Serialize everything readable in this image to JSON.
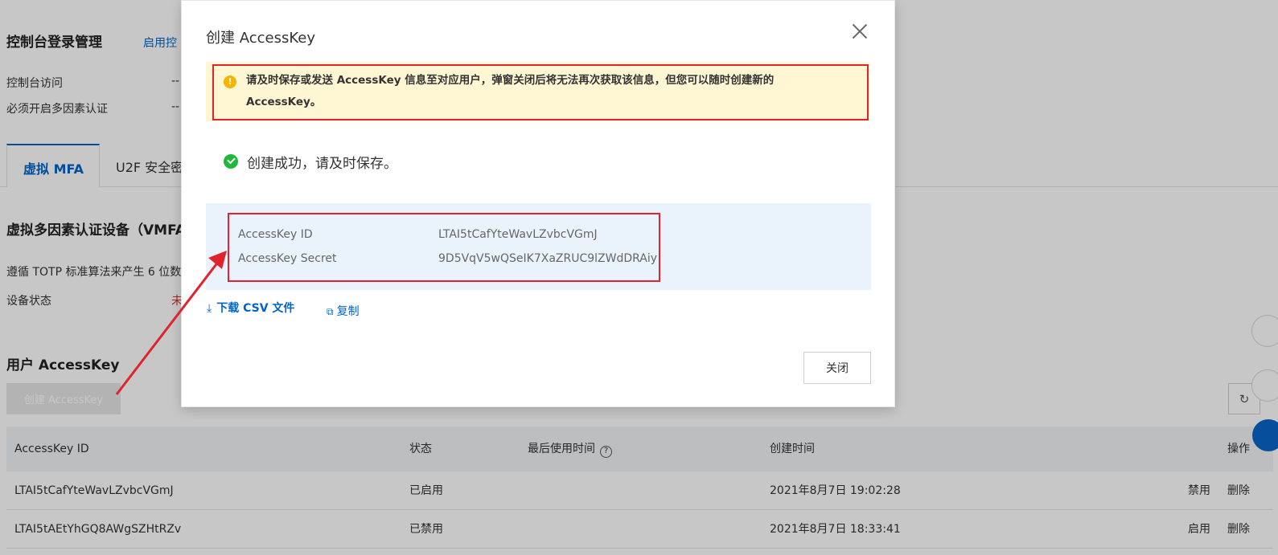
{
  "background": {
    "console_login_title": "控制台登录管理",
    "enable_link": "启用控",
    "console_access_label": "控制台访问",
    "console_access_value": "--",
    "mfa_required_label": "必须开启多因素认证",
    "mfa_required_value": "--",
    "tabs": [
      {
        "label": "虚拟 MFA"
      },
      {
        "label": "U2F 安全密"
      }
    ],
    "vmfa_title": "虚拟多因素认证设备（VMFA",
    "vmfa_desc": "遵循 TOTP 标准算法来产生 6 位数",
    "device_status_label": "设备状态",
    "device_status_value": "未",
    "accesskey_section_title": "用户 AccessKey",
    "create_button": "创建 AccessKey",
    "table": {
      "headers": [
        "AccessKey ID",
        "状态",
        "最后使用时间",
        "创建时间",
        "操作"
      ],
      "help_mark": "?",
      "rows": [
        {
          "id": "LTAI5tCafYteWavLZvbcVGmJ",
          "status": "已启用",
          "last_used": "",
          "created": "2021年8月7日 19:02:28",
          "action1": "禁用",
          "action2": "删除"
        },
        {
          "id": "LTAI5tAEtYhGQ8AWgSZHtRZv",
          "status": "已禁用",
          "last_used": "",
          "created": "2021年8月7日 18:33:41",
          "action1": "启用",
          "action2": "删除"
        }
      ]
    },
    "refresh_icon": "↻"
  },
  "dialog": {
    "title": "创建 AccessKey",
    "warning_icon": "!",
    "warning_text": "请及时保存或发送 AccessKey 信息至对应用户，弹窗关闭后将无法再次获取该信息，但您可以随时创建新的 AccessKey。",
    "success_text": "创建成功，请及时保存。",
    "key_id_label": "AccessKey ID",
    "key_id_value": "LTAI5tCafYteWavLZvbcVGmJ",
    "key_secret_label": "AccessKey Secret",
    "key_secret_value": "9D5VqV5wQSeIK7XaZRUC9lZWdDRAiy",
    "download_icon": "⤓",
    "download_label": "下载 CSV 文件",
    "copy_icon": "⧉",
    "copy_label": "复制",
    "close_button": "关闭"
  },
  "colors": {
    "link": "#0064c8",
    "highlight_border": "#e0232c",
    "warning_bg": "#fff7d4",
    "success": "#1fb83a",
    "key_panel_bg": "#eaf2fb"
  }
}
